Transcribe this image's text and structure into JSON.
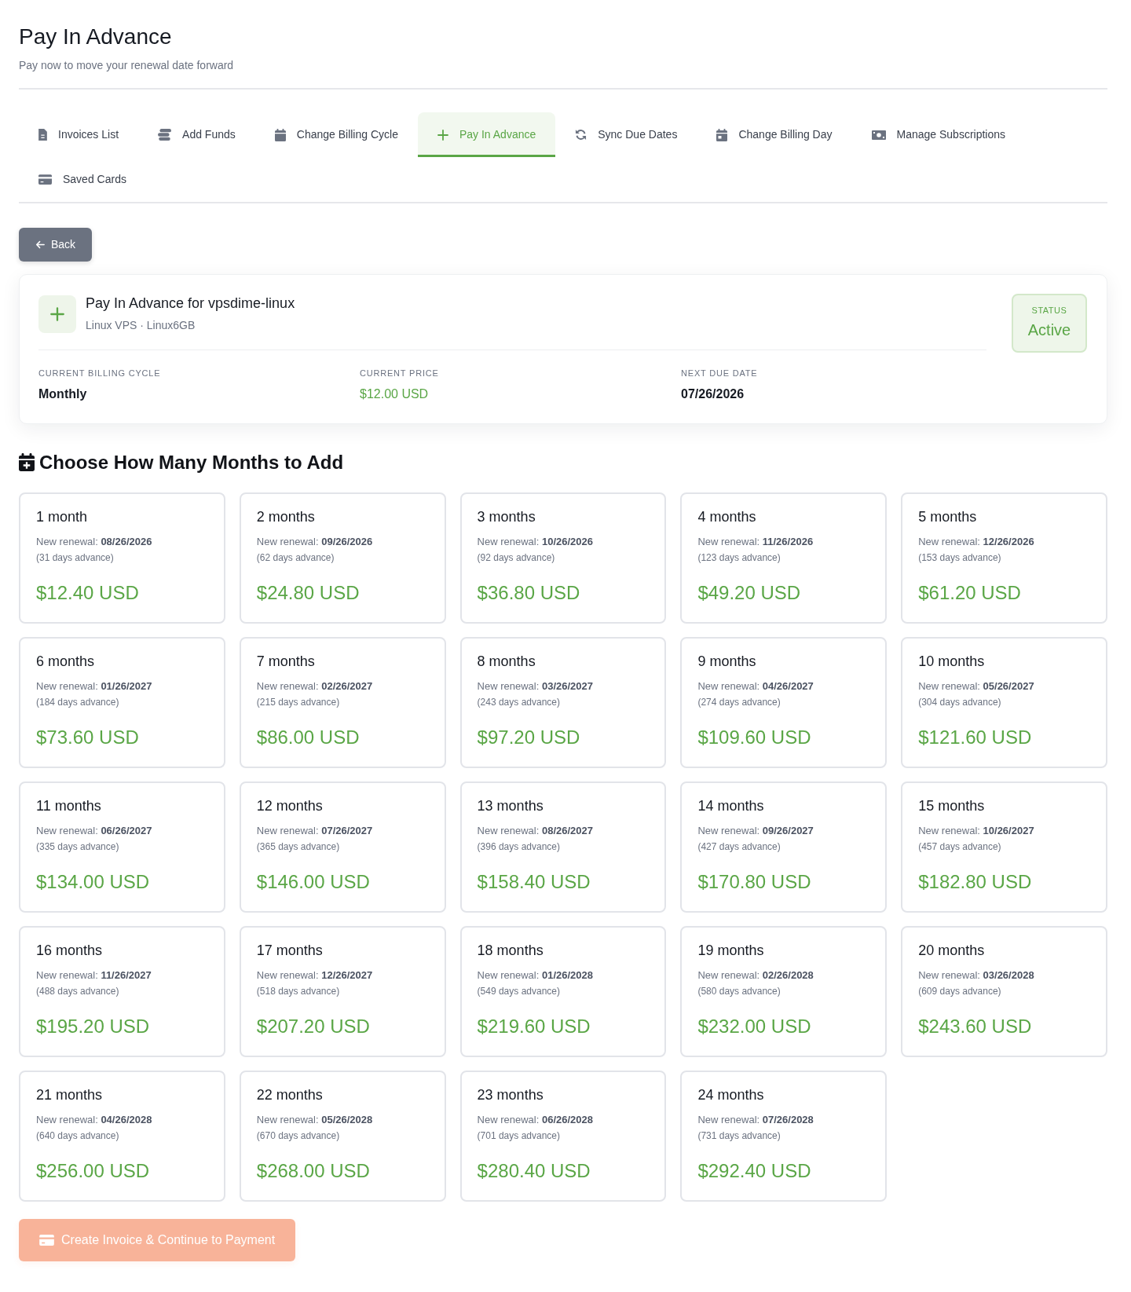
{
  "header": {
    "title": "Pay In Advance",
    "subtitle": "Pay now to move your renewal date forward"
  },
  "tabs": [
    {
      "label": "Invoices List",
      "selected": false
    },
    {
      "label": "Add Funds",
      "selected": false
    },
    {
      "label": "Change Billing Cycle",
      "selected": false
    },
    {
      "label": "Pay In Advance",
      "selected": true
    },
    {
      "label": "Sync Due Dates",
      "selected": false
    },
    {
      "label": "Change Billing Day",
      "selected": false
    },
    {
      "label": "Manage Subscriptions",
      "selected": false
    },
    {
      "label": "Saved Cards",
      "selected": false
    }
  ],
  "back_button": {
    "label": "Back"
  },
  "service": {
    "title": "Pay In Advance for vpsdime-linux",
    "subtitle": "Linux VPS · Linux6GB",
    "status": {
      "label": "STATUS",
      "value": "Active"
    },
    "details": [
      {
        "label": "CURRENT BILLING CYCLE",
        "value": "Monthly",
        "kind": "text"
      },
      {
        "label": "CURRENT PRICE",
        "value": "$12.00 USD",
        "kind": "price"
      },
      {
        "label": "NEXT DUE DATE",
        "value": "07/26/2026",
        "kind": "text"
      }
    ]
  },
  "section_title": "Choose How Many Months to Add",
  "options": [
    {
      "title": "1 month",
      "renewal": "New renewal: **08/26/2026**",
      "advance": "(31 days advance)",
      "price": "$12.40 USD",
      "selected": false
    },
    {
      "title": "2 months",
      "renewal": "New renewal: **09/26/2026**",
      "advance": "(62 days advance)",
      "price": "$24.80 USD",
      "selected": false
    },
    {
      "title": "3 months",
      "renewal": "New renewal: **10/26/2026**",
      "advance": "(92 days advance)",
      "price": "$36.80 USD",
      "selected": false
    },
    {
      "title": "4 months",
      "renewal": "New renewal: **11/26/2026**",
      "advance": "(123 days advance)",
      "price": "$49.20 USD",
      "selected": false
    },
    {
      "title": "5 months",
      "renewal": "New renewal: **12/26/2026**",
      "advance": "(153 days advance)",
      "price": "$61.20 USD",
      "selected": false
    },
    {
      "title": "6 months",
      "renewal": "New renewal: **01/26/2027**",
      "advance": "(184 days advance)",
      "price": "$73.60 USD",
      "selected": false
    },
    {
      "title": "7 months",
      "renewal": "New renewal: **02/26/2027**",
      "advance": "(215 days advance)",
      "price": "$86.00 USD",
      "selected": false
    },
    {
      "title": "8 months",
      "renewal": "New renewal: **03/26/2027**",
      "advance": "(243 days advance)",
      "price": "$97.20 USD",
      "selected": false
    },
    {
      "title": "9 months",
      "renewal": "New renewal: **04/26/2027**",
      "advance": "(274 days advance)",
      "price": "$109.60 USD",
      "selected": false
    },
    {
      "title": "10 months",
      "renewal": "New renewal: **05/26/2027**",
      "advance": "(304 days advance)",
      "price": "$121.60 USD",
      "selected": false
    },
    {
      "title": "11 months",
      "renewal": "New renewal: **06/26/2027**",
      "advance": "(335 days advance)",
      "price": "$134.00 USD",
      "selected": false
    },
    {
      "title": "12 months",
      "renewal": "New renewal: **07/26/2027**",
      "advance": "(365 days advance)",
      "price": "$146.00 USD",
      "selected": false
    },
    {
      "title": "13 months",
      "renewal": "New renewal: **08/26/2027**",
      "advance": "(396 days advance)",
      "price": "$158.40 USD",
      "selected": false
    },
    {
      "title": "14 months",
      "renewal": "New renewal: **09/26/2027**",
      "advance": "(427 days advance)",
      "price": "$170.80 USD",
      "selected": false
    },
    {
      "title": "15 months",
      "renewal": "New renewal: **10/26/2027**",
      "advance": "(457 days advance)",
      "price": "$182.80 USD",
      "selected": false
    },
    {
      "title": "16 months",
      "renewal": "New renewal: **11/26/2027**",
      "advance": "(488 days advance)",
      "price": "$195.20 USD",
      "selected": false
    },
    {
      "title": "17 months",
      "renewal": "New renewal: **12/26/2027**",
      "advance": "(518 days advance)",
      "price": "$207.20 USD",
      "selected": false
    },
    {
      "title": "18 months",
      "renewal": "New renewal: **01/26/2028**",
      "advance": "(549 days advance)",
      "price": "$219.60 USD",
      "selected": false
    },
    {
      "title": "19 months",
      "renewal": "New renewal: **02/26/2028**",
      "advance": "(580 days advance)",
      "price": "$232.00 USD",
      "selected": false
    },
    {
      "title": "20 months",
      "renewal": "New renewal: **03/26/2028**",
      "advance": "(609 days advance)",
      "price": "$243.60 USD",
      "selected": false
    },
    {
      "title": "21 months",
      "renewal": "New renewal: **04/26/2028**",
      "advance": "(640 days advance)",
      "price": "$256.00 USD",
      "selected": false
    },
    {
      "title": "22 months",
      "renewal": "New renewal: **05/26/2028**",
      "advance": "(670 days advance)",
      "price": "$268.00 USD",
      "selected": false
    },
    {
      "title": "23 months",
      "renewal": "New renewal: **06/26/2028**",
      "advance": "(701 days advance)",
      "price": "$280.40 USD",
      "selected": false
    },
    {
      "title": "24 months",
      "renewal": "New renewal: **07/26/2028**",
      "advance": "(731 days advance)",
      "price": "$292.40 USD",
      "selected": false
    }
  ],
  "submit_button": {
    "label": "Create Invoice & Continue to Payment",
    "disabled": true
  }
}
